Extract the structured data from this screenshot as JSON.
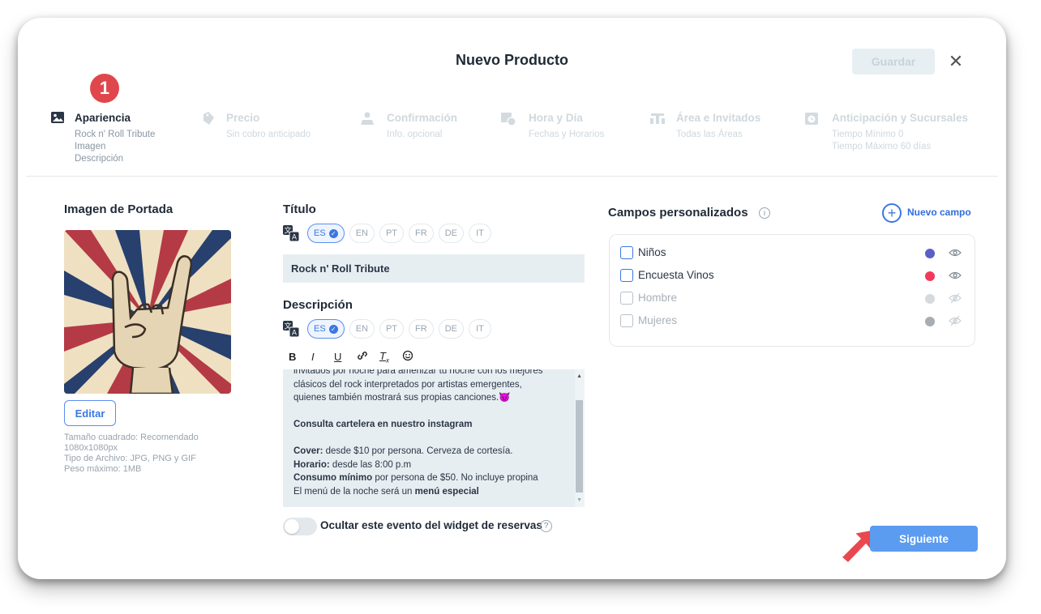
{
  "dialog": {
    "title": "Nuevo Producto",
    "save_label": "Guardar",
    "close_glyph": "✕"
  },
  "active_step_number": "1",
  "steps": [
    {
      "icon": "image-icon",
      "label": "Apariencia",
      "sub": [
        "Rock n' Roll Tribute",
        "Imagen",
        "Descripción"
      ]
    },
    {
      "icon": "price-tag-icon",
      "label": "Precio",
      "sub": [
        "Sin cobro anticipado"
      ]
    },
    {
      "icon": "confirmation-icon",
      "label": "Confirmación",
      "sub": [
        "Info. opcional"
      ]
    },
    {
      "icon": "calendar-clock-icon",
      "label": "Hora y Día",
      "sub": [
        "Fechas y Horarios"
      ]
    },
    {
      "icon": "table-guests-icon",
      "label": "Área e Invitados",
      "sub": [
        "Todas las Áreas"
      ]
    },
    {
      "icon": "clock-icon",
      "label": "Anticipación y Sucursales",
      "sub": [
        "Tiempo Mínimo 0",
        "Tiempo Máximo 60 días"
      ]
    }
  ],
  "cover": {
    "heading": "Imagen de Portada",
    "edit_label": "Editar",
    "hint": [
      "Tamaño cuadrado: Recomendado",
      "1080x1080px",
      "Tipo de Archivo: JPG, PNG y GIF",
      "Peso máximo: 1MB"
    ]
  },
  "languages": [
    "ES",
    "EN",
    "PT",
    "FR",
    "DE",
    "IT"
  ],
  "selected_language": "ES",
  "title_field": {
    "heading": "Título",
    "value": "Rock n' Roll Tribute"
  },
  "description": {
    "heading": "Descripción",
    "toolbar": [
      "B",
      "I",
      "U",
      "link-icon",
      "Tx",
      "emoji-icon"
    ],
    "toolbar_text": {
      "bold": "B",
      "italic": "I",
      "underline": "U",
      "clear": "T"
    },
    "lines": [
      {
        "parts": [
          {
            "t": "invitados por noche para amenizar tu noche con los mejores",
            "b": false
          }
        ]
      },
      {
        "parts": [
          {
            "t": "clásicos del rock interpretados por artistas emergentes,",
            "b": false
          }
        ]
      },
      {
        "parts": [
          {
            "t": "quienes también mostrará sus propias canciones.",
            "b": false
          },
          {
            "t": "😈",
            "b": false
          }
        ]
      },
      {
        "parts": []
      },
      {
        "parts": [
          {
            "t": "Consulta cartelera en nuestro instagram",
            "b": true
          }
        ]
      },
      {
        "parts": []
      },
      {
        "parts": [
          {
            "t": "Cover:",
            "b": true
          },
          {
            "t": " desde $10 por persona. Cerveza de cortesía.",
            "b": false
          }
        ]
      },
      {
        "parts": [
          {
            "t": "Horario:",
            "b": true
          },
          {
            "t": " desde las 8:00 p.m",
            "b": false
          }
        ]
      },
      {
        "parts": [
          {
            "t": "Consumo mínimo",
            "b": true
          },
          {
            "t": " por persona de $50. No incluye propina",
            "b": false
          }
        ]
      },
      {
        "parts": [
          {
            "t": "El menú de la noche será un ",
            "b": false
          },
          {
            "t": "menú especial",
            "b": true
          }
        ]
      }
    ]
  },
  "hide_toggle": {
    "label": "Ocultar este evento del widget de reservas",
    "on": false,
    "help": "?"
  },
  "custom_fields": {
    "heading": "Campos personalizados",
    "info": "i",
    "new_label": "Nuevo campo",
    "items": [
      {
        "label": "Niños",
        "color": "#5b5fc7",
        "enabled": true,
        "visible": true
      },
      {
        "label": "Encuesta Vinos",
        "color": "#f2395b",
        "enabled": true,
        "visible": true
      },
      {
        "label": "Hombre",
        "color": "#d6d9dc",
        "enabled": false,
        "visible": false
      },
      {
        "label": "Mujeres",
        "color": "#a9adb1",
        "enabled": false,
        "visible": false
      }
    ]
  },
  "next_label": "Siguiente",
  "colors": {
    "accent": "#5b9cf0",
    "step_badge": "#e0474c",
    "arrow": "#e8484e"
  }
}
